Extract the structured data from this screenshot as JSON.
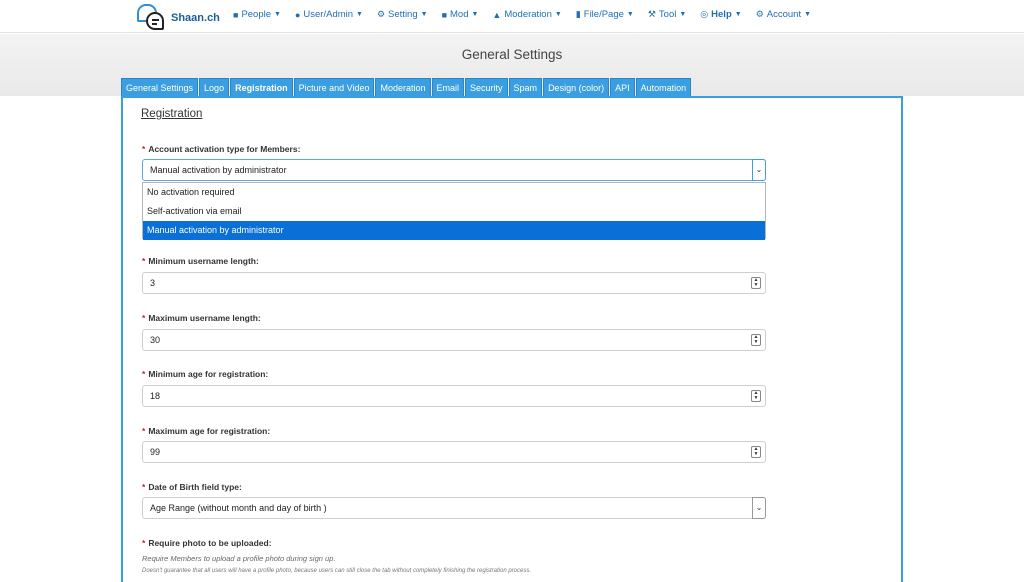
{
  "brand": {
    "name": "Shaan.ch"
  },
  "nav": [
    {
      "label": "People",
      "icon": "people-icon",
      "glyph": "■"
    },
    {
      "label": "User/Admin",
      "icon": "user-icon",
      "glyph": "●"
    },
    {
      "label": "Setting",
      "icon": "gear-icon",
      "glyph": "⚙"
    },
    {
      "label": "Mod",
      "icon": "puzzle-icon",
      "glyph": "■"
    },
    {
      "label": "Moderation",
      "icon": "user-shield-icon",
      "glyph": "▲"
    },
    {
      "label": "File/Page",
      "icon": "file-icon",
      "glyph": "▮"
    },
    {
      "label": "Tool",
      "icon": "wrench-icon",
      "glyph": "⚒"
    },
    {
      "label": "Help",
      "icon": "lifebuoy-icon",
      "glyph": "◎"
    },
    {
      "label": "Account",
      "icon": "cog-icon",
      "glyph": "⚙"
    }
  ],
  "page": {
    "title": "General Settings"
  },
  "tabs": [
    "General Settings",
    "Logo",
    "Registration",
    "Picture and Video",
    "Moderation",
    "Email",
    "Security",
    "Spam",
    "Design (color)",
    "API",
    "Automation"
  ],
  "active_tab": "Registration",
  "section": {
    "title": "Registration"
  },
  "fields": {
    "activation": {
      "label": "Account activation type for Members:",
      "value": "Manual activation by administrator",
      "options": [
        "No activation required",
        "Self-activation via email",
        "Manual activation by administrator"
      ],
      "selected_index": 2
    },
    "min_username": {
      "label": "Minimum username length:",
      "value": "3"
    },
    "max_username": {
      "label": "Maximum username length:",
      "value": "30"
    },
    "min_age": {
      "label": "Minimum age for registration:",
      "value": "18"
    },
    "max_age": {
      "label": "Maximum age for registration:",
      "value": "99"
    },
    "dob_type": {
      "label": "Date of Birth field type:",
      "value": "Age Range (without month and day of birth )"
    },
    "require_photo": {
      "label": "Require photo to be uploaded:",
      "help": "Require Members to upload a profile photo during sign up.",
      "note": "Doesn't guarantee that all users will have a profile photo, because users can still close the tab without completely finishing the registration process."
    }
  },
  "colors": {
    "accent": "#3b9ee0",
    "selected": "#0a6fd6",
    "required": "#c92323"
  }
}
